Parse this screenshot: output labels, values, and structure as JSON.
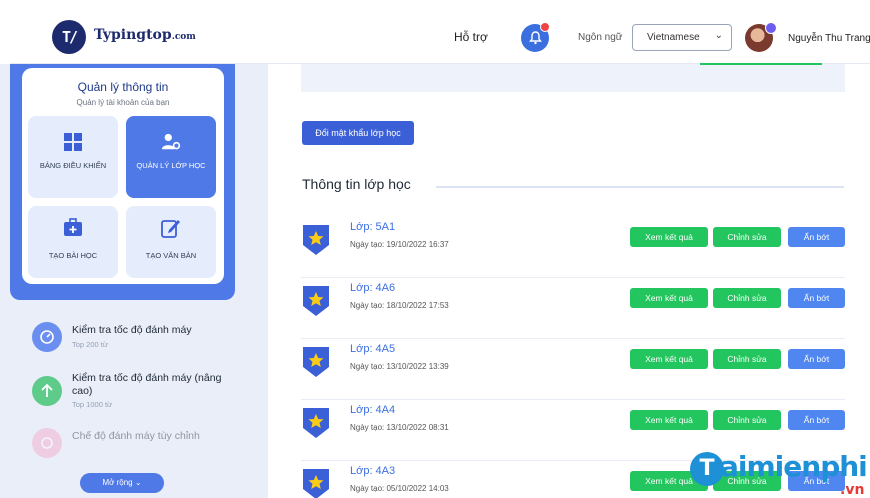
{
  "header": {
    "logo_mark": "T/",
    "logo_brand": "Typing",
    "logo_accent": "top",
    "logo_tld": ".com",
    "support_label": "Hỗ trợ",
    "language_label": "Ngôn ngữ",
    "language_value": "Vietnamese",
    "user_name": "Nguyễn Thu Trang"
  },
  "sidebar": {
    "card_title": "Quản lý thông tin",
    "card_subtitle": "Quản lý tài khoản của bạn",
    "tiles": [
      {
        "label": "BẢNG ĐIỀU KHIỂN",
        "icon": "dashboard-grid-icon"
      },
      {
        "label": "QUẢN LÝ LỚP HỌC",
        "icon": "user-settings-icon"
      },
      {
        "label": "TẠO BÀI HỌC",
        "icon": "briefcase-plus-icon"
      },
      {
        "label": "TẠO VĂN BẢN",
        "icon": "edit-icon"
      }
    ],
    "menu": [
      {
        "title": "Kiểm tra tốc độ đánh máy",
        "sub": "Top 200 từ",
        "color": "#6b8ff0"
      },
      {
        "title": "Kiểm tra tốc độ đánh máy (nâng cao)",
        "sub": "Top 1000 từ",
        "color": "#5ecb8a"
      },
      {
        "title": "Chế độ đánh máy tùy chỉnh",
        "sub": "",
        "color": "#f5a6c8"
      }
    ],
    "expand_label": "Mở rộng ⌄"
  },
  "main": {
    "change_password": "Đổi mật khẩu lớp học",
    "section_title": "Thông tin lớp học",
    "buttons": {
      "result": "Xem kết quả",
      "edit": "Chỉnh sửa",
      "hide": "Ẩn bớt"
    },
    "classes": [
      {
        "name": "Lớp: 5A1",
        "date": "Ngày tạo: 19/10/2022 16:37"
      },
      {
        "name": "Lớp: 4A6",
        "date": "Ngày tạo: 18/10/2022 17:53"
      },
      {
        "name": "Lớp: 4A5",
        "date": "Ngày tạo: 13/10/2022 13:39"
      },
      {
        "name": "Lớp: 4A4",
        "date": "Ngày tạo: 13/10/2022 08:31"
      },
      {
        "name": "Lớp: 4A3",
        "date": "Ngày tạo: 05/10/2022 14:03"
      }
    ]
  },
  "watermark": {
    "letter": "T",
    "text": "aimienphi",
    "suffix": ".vn"
  }
}
